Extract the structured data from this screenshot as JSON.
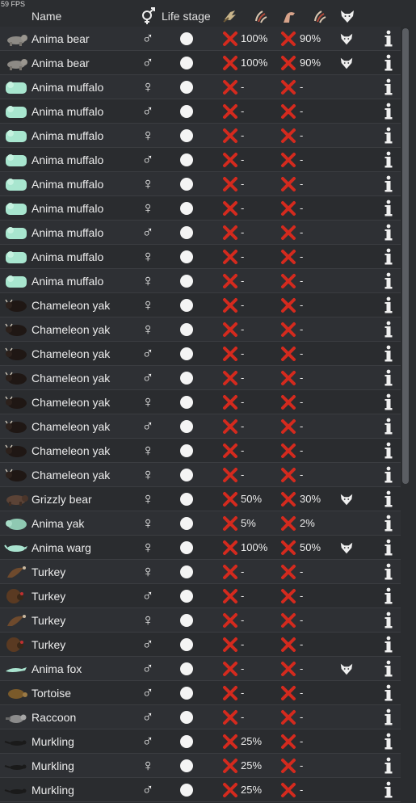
{
  "fps": "59 FPS",
  "header": {
    "name": "Name",
    "life_stage": "Life stage"
  },
  "icons": {
    "gender_column": "gender-icon",
    "tame_column": "hand-icon",
    "manhunter_tame_column": "claw-icon",
    "bond_column": "arm-icon",
    "manhunter_column": "claw-icon",
    "predator_column": "wolf-head-icon",
    "fail": "red-x-icon",
    "info": "info-icon",
    "life_stage": "adult-circle-icon"
  },
  "colors": {
    "background": "#2b2d30",
    "x_red": "#d42a1e",
    "text": "#ececec"
  },
  "rows": [
    {
      "name": "Anima bear",
      "gender": "♂",
      "tame": "100%",
      "revenge": "90%",
      "predator": true,
      "kind": "bear-gray"
    },
    {
      "name": "Anima bear",
      "gender": "♂",
      "tame": "100%",
      "revenge": "90%",
      "predator": true,
      "kind": "bear-gray"
    },
    {
      "name": "Anima muffalo",
      "gender": "♀",
      "tame": "-",
      "revenge": "-",
      "predator": false,
      "kind": "muffalo"
    },
    {
      "name": "Anima muffalo",
      "gender": "♂",
      "tame": "-",
      "revenge": "-",
      "predator": false,
      "kind": "muffalo"
    },
    {
      "name": "Anima muffalo",
      "gender": "♀",
      "tame": "-",
      "revenge": "-",
      "predator": false,
      "kind": "muffalo"
    },
    {
      "name": "Anima muffalo",
      "gender": "♂",
      "tame": "-",
      "revenge": "-",
      "predator": false,
      "kind": "muffalo"
    },
    {
      "name": "Anima muffalo",
      "gender": "♀",
      "tame": "-",
      "revenge": "-",
      "predator": false,
      "kind": "muffalo"
    },
    {
      "name": "Anima muffalo",
      "gender": "♀",
      "tame": "-",
      "revenge": "-",
      "predator": false,
      "kind": "muffalo"
    },
    {
      "name": "Anima muffalo",
      "gender": "♂",
      "tame": "-",
      "revenge": "-",
      "predator": false,
      "kind": "muffalo"
    },
    {
      "name": "Anima muffalo",
      "gender": "♀",
      "tame": "-",
      "revenge": "-",
      "predator": false,
      "kind": "muffalo"
    },
    {
      "name": "Anima muffalo",
      "gender": "♀",
      "tame": "-",
      "revenge": "-",
      "predator": false,
      "kind": "muffalo"
    },
    {
      "name": "Chameleon yak",
      "gender": "♀",
      "tame": "-",
      "revenge": "-",
      "predator": false,
      "kind": "yak"
    },
    {
      "name": "Chameleon yak",
      "gender": "♀",
      "tame": "-",
      "revenge": "-",
      "predator": false,
      "kind": "yak"
    },
    {
      "name": "Chameleon yak",
      "gender": "♂",
      "tame": "-",
      "revenge": "-",
      "predator": false,
      "kind": "yak"
    },
    {
      "name": "Chameleon yak",
      "gender": "♂",
      "tame": "-",
      "revenge": "-",
      "predator": false,
      "kind": "yak"
    },
    {
      "name": "Chameleon yak",
      "gender": "♀",
      "tame": "-",
      "revenge": "-",
      "predator": false,
      "kind": "yak"
    },
    {
      "name": "Chameleon yak",
      "gender": "♂",
      "tame": "-",
      "revenge": "-",
      "predator": false,
      "kind": "yak"
    },
    {
      "name": "Chameleon yak",
      "gender": "♀",
      "tame": "-",
      "revenge": "-",
      "predator": false,
      "kind": "yak"
    },
    {
      "name": "Chameleon yak",
      "gender": "♀",
      "tame": "-",
      "revenge": "-",
      "predator": false,
      "kind": "yak"
    },
    {
      "name": "Grizzly bear",
      "gender": "♀",
      "tame": "50%",
      "revenge": "30%",
      "predator": true,
      "kind": "bear-brown"
    },
    {
      "name": "Anima yak",
      "gender": "♀",
      "tame": "5%",
      "revenge": "2%",
      "predator": false,
      "kind": "anima-yak"
    },
    {
      "name": "Anima warg",
      "gender": "♀",
      "tame": "100%",
      "revenge": "50%",
      "predator": true,
      "kind": "warg"
    },
    {
      "name": "Turkey",
      "gender": "♀",
      "tame": "-",
      "revenge": "-",
      "predator": false,
      "kind": "turkey-hen"
    },
    {
      "name": "Turkey",
      "gender": "♂",
      "tame": "-",
      "revenge": "-",
      "predator": false,
      "kind": "turkey-tom"
    },
    {
      "name": "Turkey",
      "gender": "♀",
      "tame": "-",
      "revenge": "-",
      "predator": false,
      "kind": "turkey-hen"
    },
    {
      "name": "Turkey",
      "gender": "♂",
      "tame": "-",
      "revenge": "-",
      "predator": false,
      "kind": "turkey-tom"
    },
    {
      "name": "Anima fox",
      "gender": "♂",
      "tame": "-",
      "revenge": "-",
      "predator": true,
      "kind": "fox"
    },
    {
      "name": "Tortoise",
      "gender": "♂",
      "tame": "-",
      "revenge": "-",
      "predator": false,
      "kind": "tortoise"
    },
    {
      "name": "Raccoon",
      "gender": "♂",
      "tame": "-",
      "revenge": "-",
      "predator": false,
      "kind": "raccoon"
    },
    {
      "name": "Murkling",
      "gender": "♂",
      "tame": "25%",
      "revenge": "-",
      "predator": false,
      "kind": "murkling"
    },
    {
      "name": "Murkling",
      "gender": "♀",
      "tame": "25%",
      "revenge": "-",
      "predator": false,
      "kind": "murkling"
    },
    {
      "name": "Murkling",
      "gender": "♂",
      "tame": "25%",
      "revenge": "-",
      "predator": false,
      "kind": "murkling"
    }
  ]
}
